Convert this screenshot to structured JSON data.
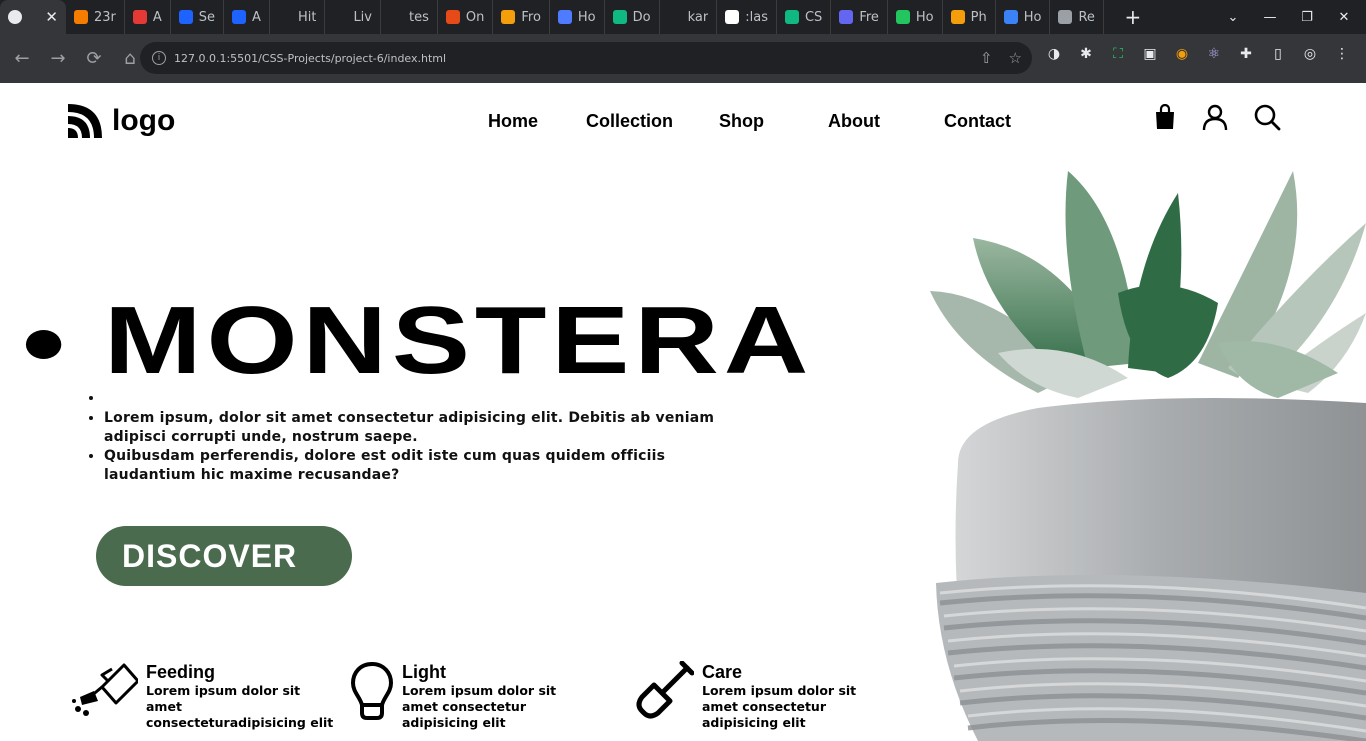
{
  "browser": {
    "active_tab": {
      "close": "✕"
    },
    "tabs": [
      {
        "title": "23r",
        "color": "#f57c00"
      },
      {
        "title": "A",
        "color": "#e53935"
      },
      {
        "title": "Se",
        "color": "#1e63ff"
      },
      {
        "title": "A",
        "color": "#1e63ff"
      },
      {
        "title": "Hit",
        "color": "#202124"
      },
      {
        "title": "Liv",
        "color": "#202124"
      },
      {
        "title": "tes",
        "color": "#202124"
      },
      {
        "title": "On",
        "color": "#e64a19"
      },
      {
        "title": "Fro",
        "color": "#f59e0b"
      },
      {
        "title": "Ho",
        "color": "#4f7cff"
      },
      {
        "title": "Do",
        "color": "#10b981"
      },
      {
        "title": "kar",
        "color": "#202124"
      },
      {
        "title": ":las",
        "color": "#ffffff"
      },
      {
        "title": "CS",
        "color": "#10b981"
      },
      {
        "title": "Fre",
        "color": "#6366f1"
      },
      {
        "title": "Ho",
        "color": "#22c55e"
      },
      {
        "title": "Ph",
        "color": "#f59e0b"
      },
      {
        "title": "Ho",
        "color": "#3b82f6"
      },
      {
        "title": "Re",
        "color": "#9aa0a6"
      }
    ],
    "new_tab": "+",
    "url": "127.0.0.1:5501/CSS-Projects/project-6/index.html"
  },
  "header": {
    "logo_text": "logo",
    "nav": [
      "Home",
      "Collection",
      "Shop",
      "About",
      "Contact"
    ]
  },
  "hero": {
    "title": "MONSTERA",
    "paragraphs": [
      "Lorem ipsum, dolor sit amet consectetur adipisicing elit. Debitis ab veniam adipisci corrupti unde, nostrum saepe.",
      "Quibusdam perferendis, dolore est odit iste cum quas quidem officiis laudantium hic maxime recusandae?"
    ],
    "button": "DISCOVER",
    "button_color": "#4a6b4e"
  },
  "features": [
    {
      "title": "Feeding",
      "desc": "Lorem ipsum dolor sit amet consecteturadipisicing elit",
      "icon": "watering-can-icon"
    },
    {
      "title": "Light",
      "desc": "Lorem ipsum dolor sit amet consectetur adipisicing elit",
      "icon": "lightbulb-icon"
    },
    {
      "title": "Care",
      "desc": "Lorem ipsum dolor sit amet consectetur adipisicing elit",
      "icon": "shovel-icon"
    }
  ]
}
